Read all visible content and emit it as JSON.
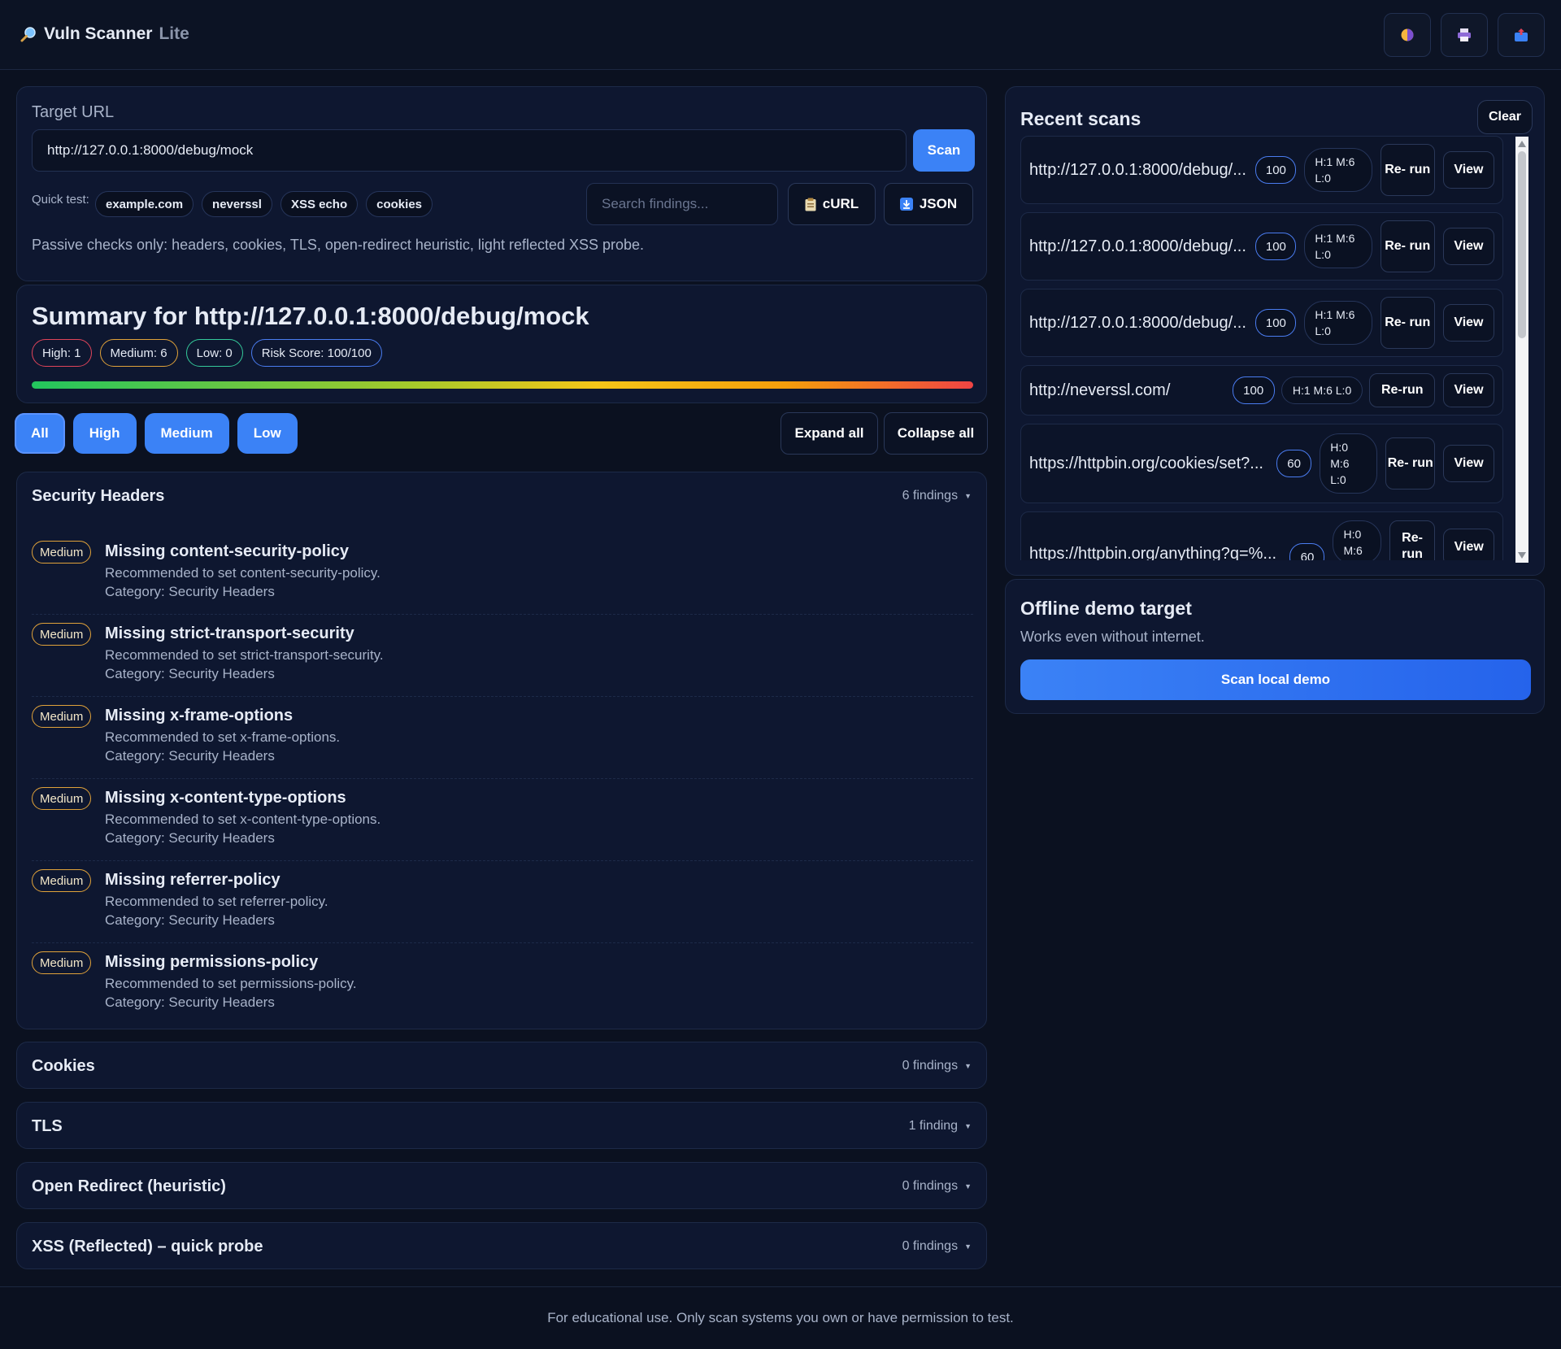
{
  "app": {
    "name": "Vuln Scanner",
    "name_suffix": "Lite"
  },
  "header_icons": [
    "theme-toggle-icon",
    "print-icon",
    "export-icon"
  ],
  "target": {
    "label": "Target URL",
    "url": "http://127.0.0.1:8000/debug/mock",
    "scan_label": "Scan",
    "quick_label": "Quick test:",
    "quick_tests": [
      "example.com",
      "neverssl",
      "XSS echo",
      "cookies"
    ],
    "search_placeholder": "Search findings...",
    "curl_label": "cURL",
    "json_label": "JSON",
    "note": "Passive checks only: headers, cookies, TLS, open-redirect heuristic, light reflected XSS probe."
  },
  "summary": {
    "title": "Summary for http://127.0.0.1:8000/debug/mock",
    "high": "High: 1",
    "medium": "Medium: 6",
    "low": "Low: 0",
    "risk": "Risk Score: 100/100",
    "risk_score": 100
  },
  "filters": {
    "all": "All",
    "high": "High",
    "medium": "Medium",
    "low": "Low",
    "expand": "Expand all",
    "collapse": "Collapse all",
    "active": "All"
  },
  "sections": {
    "headers": {
      "title": "Security Headers",
      "count": "6 findings",
      "findings": [
        {
          "severity": "Medium",
          "title": "Missing content-security-policy",
          "desc": "Recommended to set content-security-policy.",
          "category": "Category: Security Headers"
        },
        {
          "severity": "Medium",
          "title": "Missing strict-transport-security",
          "desc": "Recommended to set strict-transport-security.",
          "category": "Category: Security Headers"
        },
        {
          "severity": "Medium",
          "title": "Missing x-frame-options",
          "desc": "Recommended to set x-frame-options.",
          "category": "Category: Security Headers"
        },
        {
          "severity": "Medium",
          "title": "Missing x-content-type-options",
          "desc": "Recommended to set x-content-type-options.",
          "category": "Category: Security Headers"
        },
        {
          "severity": "Medium",
          "title": "Missing referrer-policy",
          "desc": "Recommended to set referrer-policy.",
          "category": "Category: Security Headers"
        },
        {
          "severity": "Medium",
          "title": "Missing permissions-policy",
          "desc": "Recommended to set permissions-policy.",
          "category": "Category: Security Headers"
        }
      ]
    },
    "cookies": {
      "title": "Cookies",
      "count": "0 findings"
    },
    "tls": {
      "title": "TLS",
      "count": "1 finding"
    },
    "redirect": {
      "title": "Open Redirect (heuristic)",
      "count": "0 findings"
    },
    "xss": {
      "title": "XSS (Reflected) – quick probe",
      "count": "0 findings"
    }
  },
  "recent": {
    "title": "Recent scans",
    "clear_label": "Clear",
    "rerun_label": "Re-run",
    "rerun_label_wrapped": "Re- run",
    "view_label": "View",
    "items": [
      {
        "url": "http://127.0.0.1:8000/debug/...",
        "score": "100",
        "counts": "H:1 M:6 L:0"
      },
      {
        "url": "http://127.0.0.1:8000/debug/...",
        "score": "100",
        "counts": "H:1 M:6 L:0"
      },
      {
        "url": "http://127.0.0.1:8000/debug/...",
        "score": "100",
        "counts": "H:1 M:6 L:0"
      },
      {
        "url": "http://neverssl.com/",
        "score": "100",
        "counts": "H:1 M:6 L:0"
      },
      {
        "url": "https://httpbin.org/cookies/set?...",
        "score": "60",
        "counts": "H:0 M:6 L:0"
      },
      {
        "url": "https://httpbin.org/anything?q=%...",
        "score": "60",
        "counts": "H:0 M:6"
      }
    ]
  },
  "offline": {
    "title": "Offline demo target",
    "subtitle": "Works even without internet.",
    "button": "Scan local demo"
  },
  "footer": "For educational use. Only scan systems you own or have permission to test."
}
